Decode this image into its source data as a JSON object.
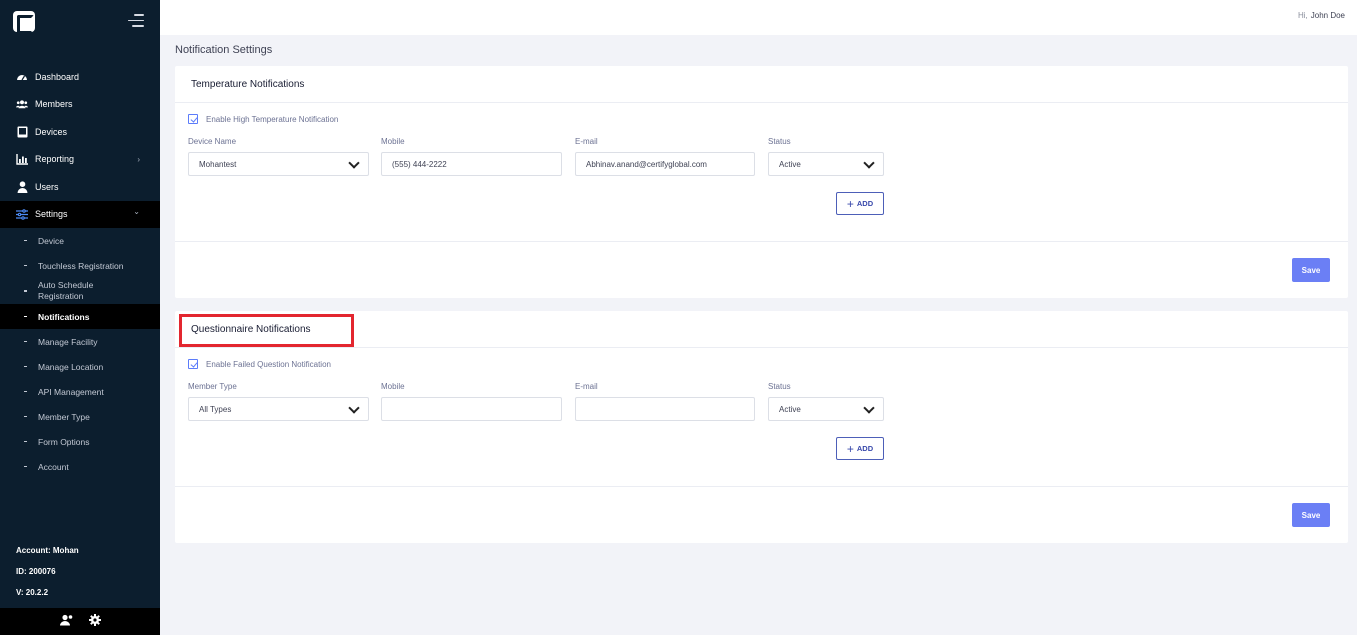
{
  "user": {
    "greeting": "Hi,",
    "name": "John Doe"
  },
  "page_title": "Notification Settings",
  "sidebar": {
    "items": [
      {
        "label": "Dashboard",
        "icon": "dashboard-icon"
      },
      {
        "label": "Members",
        "icon": "members-icon"
      },
      {
        "label": "Devices",
        "icon": "devices-icon"
      },
      {
        "label": "Reporting",
        "icon": "reporting-icon",
        "chevron": "›"
      },
      {
        "label": "Users",
        "icon": "user-icon"
      },
      {
        "label": "Settings",
        "icon": "settings-sliders-icon",
        "chevron": "⌄"
      }
    ],
    "sub_items": [
      "Device",
      "Touchless Registration",
      "Auto Schedule Registration",
      "Notifications",
      "Manage Facility",
      "Manage Location",
      "API Management",
      "Member Type",
      "Form Options",
      "Account"
    ],
    "account": "Account: Mohan",
    "id": "ID: 200076",
    "version": "V: 20.2.2"
  },
  "temperature": {
    "title": "Temperature Notifications",
    "checkbox_label": "Enable High Temperature Notification",
    "labels": {
      "device": "Device Name",
      "mobile": "Mobile",
      "email": "E-mail",
      "status": "Status"
    },
    "values": {
      "device": "Mohantest",
      "mobile": "(555) 444-2222",
      "email": "Abhinav.anand@certifyglobal.com",
      "status": "Active"
    },
    "add_label": "ADD",
    "save_label": "Save"
  },
  "questionnaire": {
    "title": "Questionnaire Notifications",
    "checkbox_label": "Enable Failed Question Notification",
    "labels": {
      "member_type": "Member Type",
      "mobile": "Mobile",
      "email": "E-mail",
      "status": "Status"
    },
    "values": {
      "member_type": "All Types",
      "mobile": "",
      "email": "",
      "status": "Active"
    },
    "add_label": "ADD",
    "save_label": "Save"
  },
  "colors": {
    "sidebar_bg": "#0c1e2e",
    "accent": "#6b7ff5",
    "highlight": "#e3262f"
  }
}
